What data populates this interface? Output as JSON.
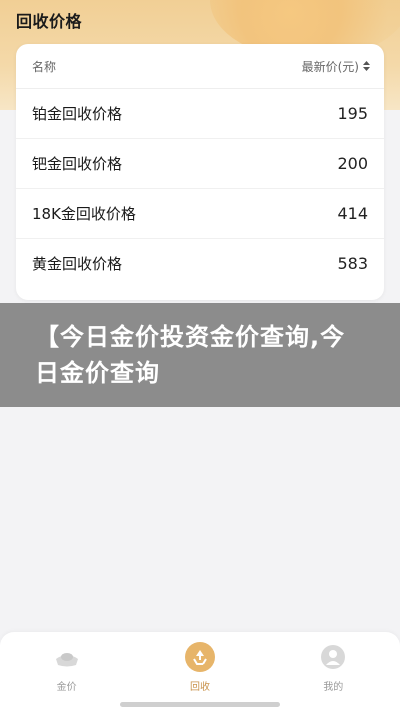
{
  "header": {
    "title": "回收价格"
  },
  "table": {
    "col_name": "名称",
    "col_price": "最新价(元)",
    "rows": [
      {
        "name": "铂金回收价格",
        "price": "195"
      },
      {
        "name": "钯金回收价格",
        "price": "200"
      },
      {
        "name": "18K金回收价格",
        "price": "414"
      },
      {
        "name": "黄金回收价格",
        "price": "583"
      }
    ]
  },
  "update_time": "",
  "overlay": {
    "text": "【今日金价投资金价查询,今日金价查询"
  },
  "nav": {
    "items": [
      {
        "label": "金价",
        "icon": "gold-ingot-icon"
      },
      {
        "label": "回收",
        "icon": "recycle-icon"
      },
      {
        "label": "我的",
        "icon": "profile-icon"
      }
    ],
    "active_index": 1
  },
  "colors": {
    "header_gold": "#f1cf95",
    "accent_gold": "#e7b56a",
    "overlay_gray": "#6e6e6e"
  }
}
